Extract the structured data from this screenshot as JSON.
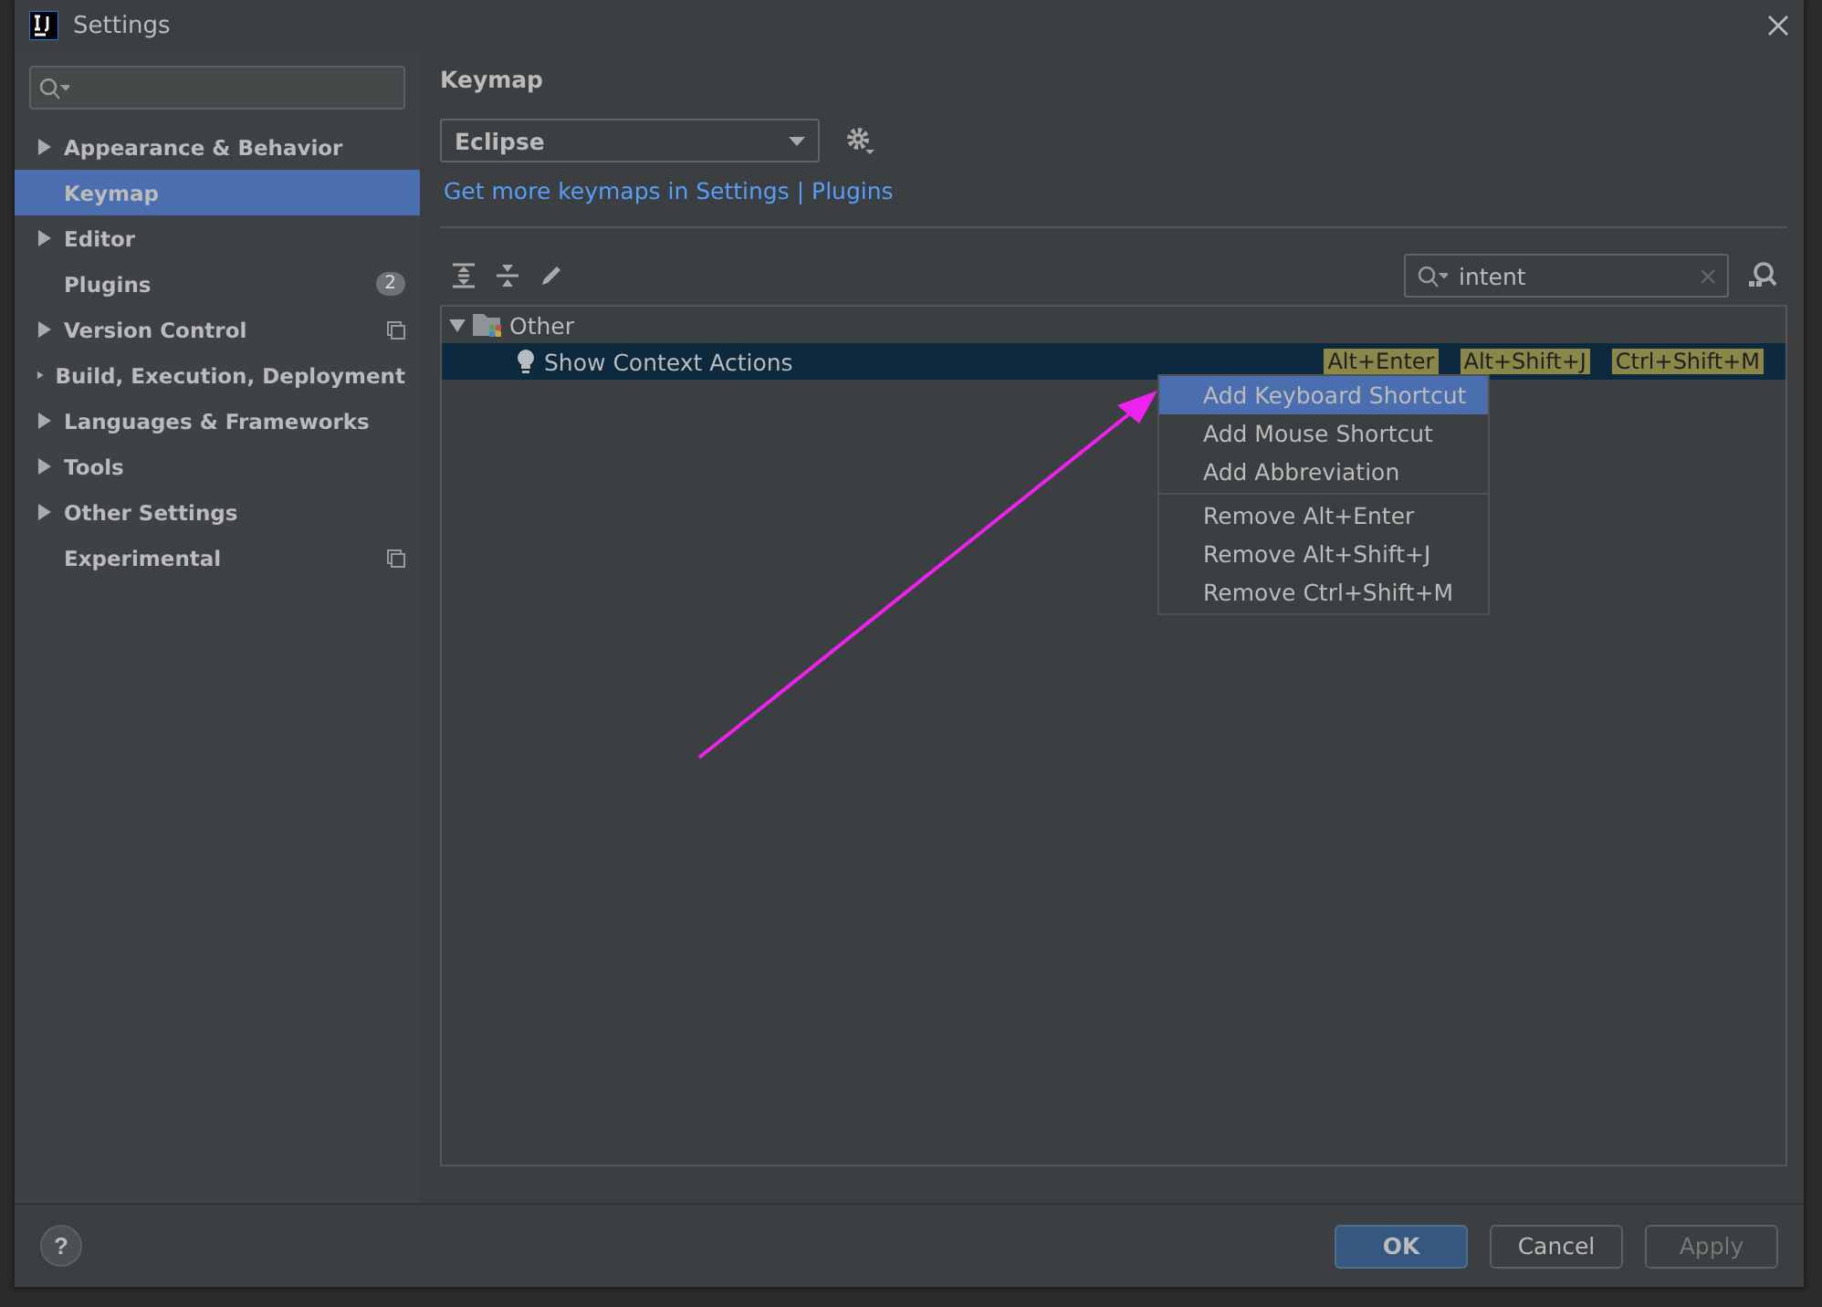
{
  "window": {
    "title": "Settings"
  },
  "sidebar": {
    "items": [
      {
        "label": "Appearance & Behavior",
        "expandable": true,
        "selected": false
      },
      {
        "label": "Keymap",
        "expandable": false,
        "selected": true
      },
      {
        "label": "Editor",
        "expandable": true,
        "selected": false
      },
      {
        "label": "Plugins",
        "expandable": false,
        "selected": false,
        "badge": "2"
      },
      {
        "label": "Version Control",
        "expandable": true,
        "selected": false,
        "project_scope": true
      },
      {
        "label": "Build, Execution, Deployment",
        "expandable": true,
        "selected": false
      },
      {
        "label": "Languages & Frameworks",
        "expandable": true,
        "selected": false
      },
      {
        "label": "Tools",
        "expandable": true,
        "selected": false
      },
      {
        "label": "Other Settings",
        "expandable": true,
        "selected": false
      },
      {
        "label": "Experimental",
        "expandable": false,
        "selected": false,
        "project_scope": true
      }
    ]
  },
  "content": {
    "title": "Keymap",
    "keymap": "Eclipse",
    "link": "Get more keymaps in Settings | Plugins",
    "search": {
      "value": "intent"
    },
    "tree": [
      {
        "label": "Other",
        "expanded": true,
        "children": [
          {
            "label": "Show Context Actions",
            "selected": true,
            "shortcuts": [
              "Alt+Enter",
              "Alt+Shift+J",
              "Ctrl+Shift+M"
            ]
          }
        ]
      }
    ]
  },
  "context_menu": {
    "groups": [
      [
        {
          "label": "Add Keyboard Shortcut",
          "selected": true
        },
        {
          "label": "Add Mouse Shortcut",
          "selected": false
        },
        {
          "label": "Add Abbreviation",
          "selected": false
        }
      ],
      [
        {
          "label": "Remove Alt+Enter",
          "selected": false
        },
        {
          "label": "Remove Alt+Shift+J",
          "selected": false
        },
        {
          "label": "Remove Ctrl+Shift+M",
          "selected": false
        }
      ]
    ]
  },
  "footer": {
    "help": "?",
    "buttons": [
      {
        "label": "OK",
        "kind": "primary",
        "disabled": false
      },
      {
        "label": "Cancel",
        "kind": "normal",
        "disabled": false
      },
      {
        "label": "Apply",
        "kind": "normal",
        "disabled": true
      }
    ]
  }
}
